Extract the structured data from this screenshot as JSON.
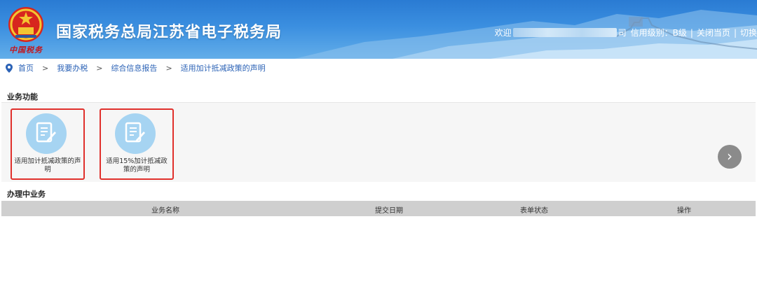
{
  "header": {
    "title": "国家税务总局江苏省电子税务局",
    "seal_text": "中国税务",
    "welcome": "欢迎",
    "company_suffix": "司",
    "credit_label": "信用级别：B级",
    "divider": "|",
    "close_label": "关闭当页",
    "switch_label": "切换"
  },
  "breadcrumb": {
    "items": [
      "首页",
      "我要办税",
      "综合信息报告",
      "适用加计抵减政策的声明"
    ],
    "separator": ">"
  },
  "business_functions": {
    "title": "业务功能",
    "items": [
      {
        "label": "适用加计抵减政策的声明",
        "icon": "document-edit-icon"
      },
      {
        "label": "适用15%加计抵减政策的声明",
        "icon": "document-edit-icon"
      }
    ],
    "next_icon": "chevron-right-icon",
    "next_glyph": "›"
  },
  "in_progress": {
    "title": "办理中业务",
    "columns": [
      "业务名称",
      "提交日期",
      "表单状态",
      "操作"
    ],
    "rows": []
  },
  "colors": {
    "header_blue": "#2a7bd3",
    "link_blue": "#2b62b6",
    "highlight_red": "#e0302c",
    "icon_circle": "#a6d4f2",
    "table_header": "#cfcfcf"
  }
}
